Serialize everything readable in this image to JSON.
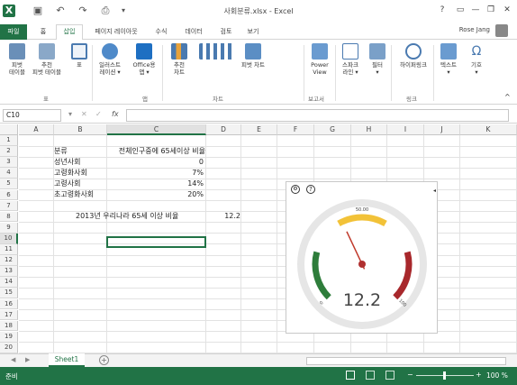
{
  "window": {
    "title": "사회분류.xlsx - Excel",
    "user": "Rose Jang"
  },
  "tabs": [
    "파일",
    "홈",
    "삽입",
    "페이지 레이아웃",
    "수식",
    "데이터",
    "검토",
    "보기"
  ],
  "ribbon": {
    "b1": "피벗\n테이블",
    "b2": "추천\n피벗 테이블",
    "b3": "표",
    "b4": "일러스트\n레이션 ▾",
    "b5": "Office용\n앱 ▾",
    "b6": "추천\n차트",
    "b7": "피벗 차트",
    "b8": "Power\nView",
    "b9": "스파크\n라인 ▾",
    "b10": "필터\n▾",
    "b11": "하이퍼링크",
    "b12": "텍스트\n▾",
    "b13": "기호\n▾",
    "g1": "표",
    "g2": "앱",
    "g3": "차트",
    "g4": "보고서",
    "g5": "링크"
  },
  "formula_bar": {
    "name_box": "C10",
    "fx": "fx",
    "content": ""
  },
  "columns": [
    "A",
    "B",
    "C",
    "D",
    "E",
    "F",
    "G",
    "H",
    "I",
    "J",
    "K"
  ],
  "rows": [
    "1",
    "2",
    "3",
    "4",
    "5",
    "6",
    "7",
    "8",
    "9",
    "10",
    "11",
    "12",
    "13",
    "14",
    "15",
    "16",
    "17",
    "18",
    "19",
    "20"
  ],
  "cells": {
    "b2": "분류",
    "c2": "전체인구중에 65세이상 비율",
    "b3": "성년사회",
    "c3": "0",
    "b4": "고령화사회",
    "c4": "7%",
    "b5": "고령사회",
    "c5": "14%",
    "b6": "초고령화사회",
    "c6": "20%",
    "b8": "2013년 우리나라 65세 이상 비율",
    "d8": "12.2"
  },
  "gauge": {
    "value": "12.2",
    "min_label": "0",
    "max_label": "100",
    "top_label": "50.00",
    "gauge_value": 12.2,
    "scale_min": 0,
    "scale_max": 30
  },
  "sheet": {
    "tab": "Sheet1"
  },
  "status": {
    "left": "준비",
    "zoom": "100 %"
  }
}
